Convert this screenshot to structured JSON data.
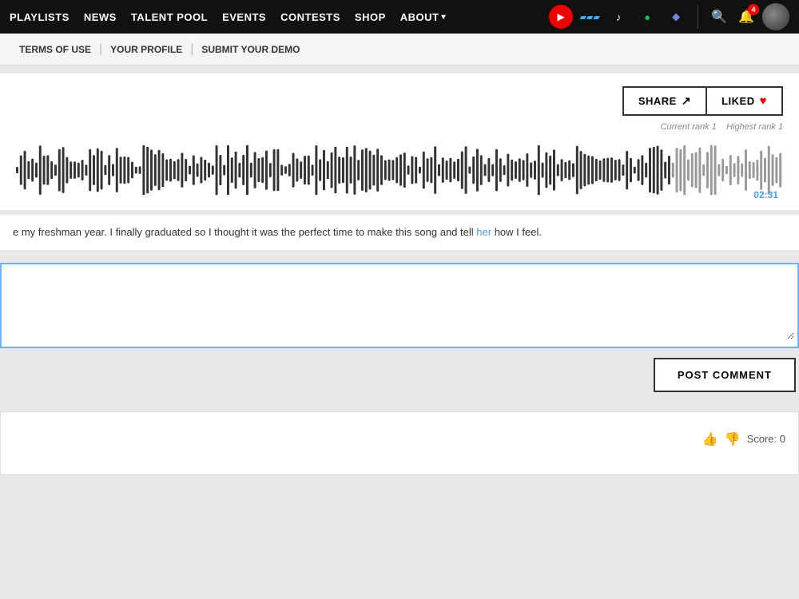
{
  "navbar": {
    "links": [
      {
        "label": "PLAYLISTS",
        "id": "playlists"
      },
      {
        "label": "NEWS",
        "id": "news"
      },
      {
        "label": "TALENT POOL",
        "id": "talent-pool"
      },
      {
        "label": "EVENTS",
        "id": "events"
      },
      {
        "label": "CONTESTS",
        "id": "contests"
      },
      {
        "label": "SHOP",
        "id": "shop"
      },
      {
        "label": "ABOUT",
        "id": "about"
      }
    ],
    "icons": [
      {
        "id": "youtube",
        "symbol": "▶",
        "class": "youtube"
      },
      {
        "id": "equalizer",
        "symbol": "▬",
        "class": "equalizer"
      },
      {
        "id": "music",
        "symbol": "♪",
        "class": "music"
      },
      {
        "id": "spotify",
        "symbol": "●",
        "class": "spotify"
      },
      {
        "id": "discord",
        "symbol": "◆",
        "class": "discord"
      }
    ],
    "bell_badge": "4"
  },
  "secondary_nav": {
    "links": [
      {
        "label": "TERMS OF USE",
        "id": "terms"
      },
      {
        "label": "YOUR PROFILE",
        "id": "profile"
      },
      {
        "label": "SUBMIT YOUR DEMO",
        "id": "submit-demo"
      }
    ]
  },
  "player": {
    "share_label": "SHARE",
    "liked_label": "LIKED",
    "rank_current": "Current rank 1",
    "rank_highest": "Highest rank 1",
    "time": "02:31"
  },
  "description": {
    "text_prefix": "e my freshman year. I finally graduated so I thought it was the perfect time to make this song and tell",
    "link_text": "her",
    "text_suffix": " how I feel."
  },
  "comment": {
    "textarea_placeholder": "",
    "post_button_label": "POST COMMENT"
  },
  "comment_item": {
    "score_label": "Score: 0"
  }
}
